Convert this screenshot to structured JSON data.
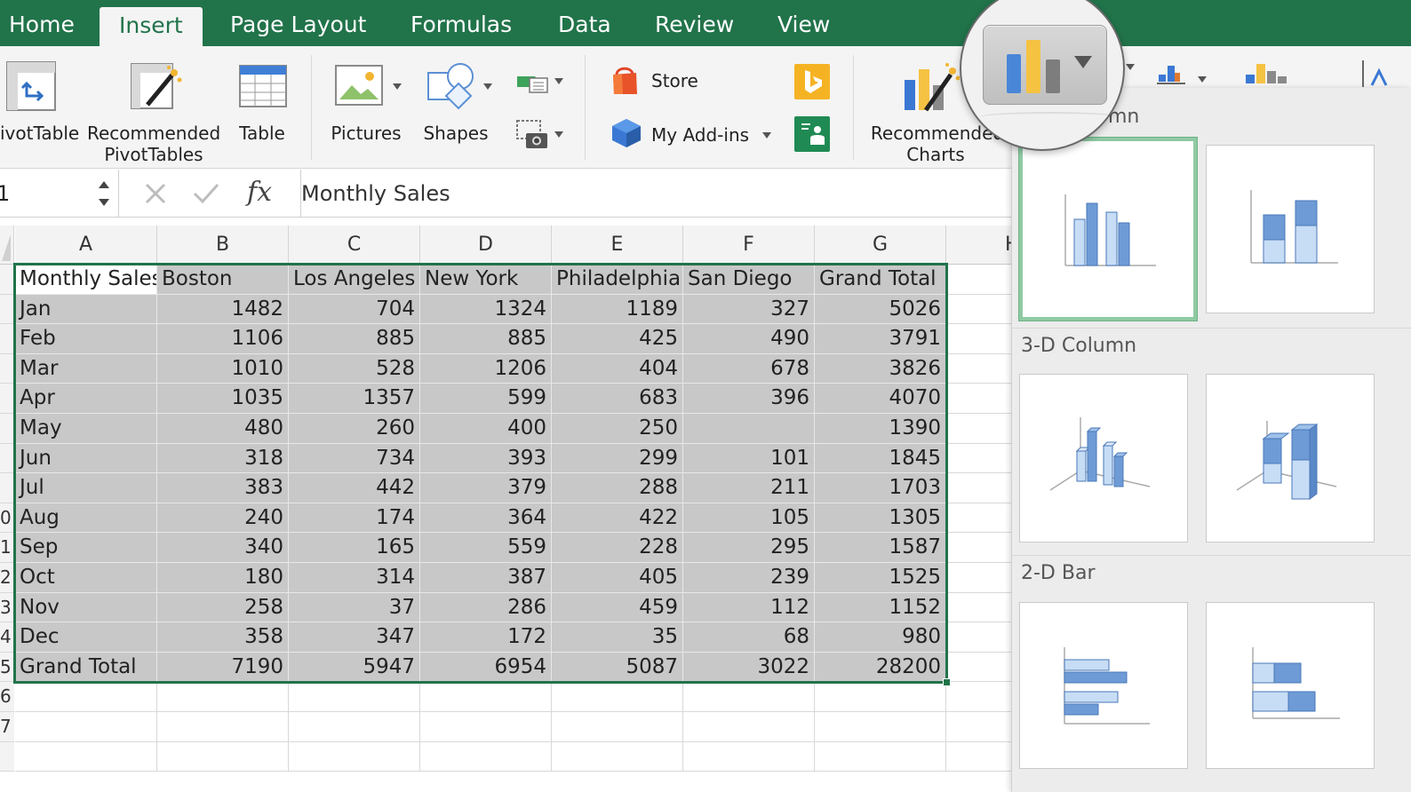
{
  "tabs": [
    {
      "label": "Home",
      "active": false
    },
    {
      "label": "Insert",
      "active": true
    },
    {
      "label": "Page Layout",
      "active": false
    },
    {
      "label": "Formulas",
      "active": false
    },
    {
      "label": "Data",
      "active": false
    },
    {
      "label": "Review",
      "active": false
    },
    {
      "label": "View",
      "active": false
    }
  ],
  "ribbon": {
    "pivottable": "ivotTable",
    "recommended_pivottables_1": "Recommended",
    "recommended_pivottables_2": "PivotTables",
    "table": "Table",
    "pictures": "Pictures",
    "shapes": "Shapes",
    "store": "Store",
    "my_addins": "My Add-ins",
    "recommended_charts_1": "Recommended",
    "recommended_charts_2": "Charts"
  },
  "formula_bar": {
    "name_box": "1",
    "fx_label": "fx",
    "value": "Monthly Sales"
  },
  "columns": [
    "A",
    "B",
    "C",
    "D",
    "E",
    "F",
    "G",
    "H"
  ],
  "row_numbers": [
    "",
    "",
    "",
    "",
    "",
    "",
    "",
    "",
    "0",
    "1",
    "2",
    "3",
    "4",
    "5",
    "6",
    "7"
  ],
  "table": {
    "header": [
      "Monthly Sales",
      "Boston",
      "Los Angeles",
      "New York",
      "Philadelphia",
      "San Diego",
      "Grand Total"
    ],
    "rows": [
      [
        "Jan",
        "1482",
        "704",
        "1324",
        "1189",
        "327",
        "5026"
      ],
      [
        "Feb",
        "1106",
        "885",
        "885",
        "425",
        "490",
        "3791"
      ],
      [
        "Mar",
        "1010",
        "528",
        "1206",
        "404",
        "678",
        "3826"
      ],
      [
        "Apr",
        "1035",
        "1357",
        "599",
        "683",
        "396",
        "4070"
      ],
      [
        "May",
        "480",
        "260",
        "400",
        "250",
        "",
        "1390"
      ],
      [
        "Jun",
        "318",
        "734",
        "393",
        "299",
        "101",
        "1845"
      ],
      [
        "Jul",
        "383",
        "442",
        "379",
        "288",
        "211",
        "1703"
      ],
      [
        "Aug",
        "240",
        "174",
        "364",
        "422",
        "105",
        "1305"
      ],
      [
        "Sep",
        "340",
        "165",
        "559",
        "228",
        "295",
        "1587"
      ],
      [
        "Oct",
        "180",
        "314",
        "387",
        "405",
        "239",
        "1525"
      ],
      [
        "Nov",
        "258",
        "37",
        "286",
        "459",
        "112",
        "1152"
      ],
      [
        "Dec",
        "358",
        "347",
        "172",
        "35",
        "68",
        "980"
      ],
      [
        "Grand Total",
        "7190",
        "5947",
        "6954",
        "5087",
        "3022",
        "28200"
      ]
    ]
  },
  "chart_panel": {
    "group_top_partial": "mn",
    "group_3d_column": "3-D Column",
    "group_2d_bar": "2-D Bar"
  },
  "colors": {
    "brand_green": "#21734a",
    "selection_fill": "#c8c8c8",
    "chart_blue": "#4a86d8",
    "chart_yellow": "#f5c242"
  }
}
